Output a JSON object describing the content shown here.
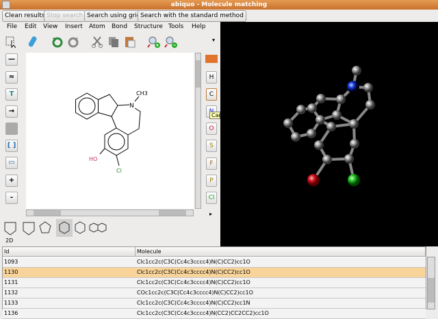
{
  "window": {
    "title": "abiquo - Molecule matching"
  },
  "actions": {
    "clean": "Clean results",
    "stop": "Stop search",
    "grid": "Search using grid",
    "standard": "Search with the standard method"
  },
  "menu": [
    "File",
    "Edit",
    "View",
    "Insert",
    "Atom",
    "Bond",
    "Structure",
    "Tools",
    "Help"
  ],
  "atoms": [
    "H",
    "C",
    "N",
    "O",
    "S",
    "F",
    "P",
    "Cl"
  ],
  "tooltip": "Car",
  "molecule_labels": {
    "n": "N",
    "ch3": "CH3",
    "ho": "HO",
    "cl": "Cl"
  },
  "status": "2D",
  "table": {
    "headers": [
      "Id",
      "Molecule"
    ],
    "rows": [
      {
        "id": "1093",
        "smiles": "Clc1cc2c(C3C(Cc4c3cccc4)N(C)CC2)cc1O"
      },
      {
        "id": "1130",
        "smiles": "Clc1cc2c(C3C(Cc4c3cccc4)N(C)CC2)cc1O"
      },
      {
        "id": "1131",
        "smiles": "Clc1cc2c(C3C(Cc4c3cccc4)N(C)CC2)cc1O"
      },
      {
        "id": "1132",
        "smiles": "COc1cc2c(C3C(Cc4c3cccc4)N(C)CC2)cc1O"
      },
      {
        "id": "1133",
        "smiles": "Clc1cc2c(C3C(Cc4c3cccc4)N(C)CC2)cc1N"
      },
      {
        "id": "1136",
        "smiles": "Clc1cc2c(C3C(Cc4c3cccc4)N(CC2)CC2CC2)cc1O"
      }
    ],
    "selected_id": "1130"
  },
  "colors": {
    "selected_row": "#f8d49a",
    "title_bar": "#d98540",
    "oxygen": "#d01030",
    "chlorine": "#20c020",
    "nitrogen": "#1030d0"
  }
}
